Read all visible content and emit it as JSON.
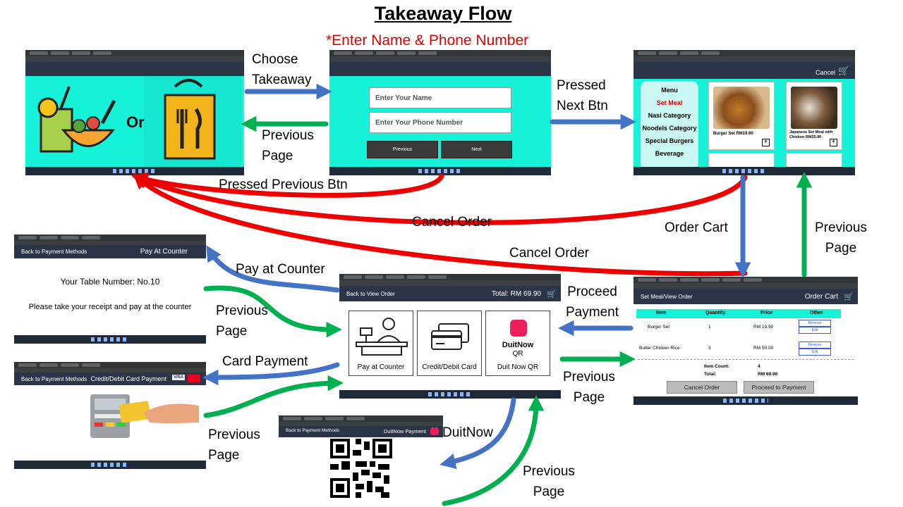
{
  "title": "Takeaway Flow",
  "note": "*Enter Name & Phone Number",
  "labels": {
    "choose_takeaway": [
      "Choose",
      "Takeaway"
    ],
    "prev_page_1": [
      "Previous",
      "Page"
    ],
    "pressed_next": [
      "Pressed",
      "Next Btn"
    ],
    "pressed_prev_btn": "Pressed Previous Btn",
    "cancel_order_1": "Cancel Order",
    "cancel_order_2": "Cancel Order",
    "order_cart": "Order Cart",
    "prev_page_2": [
      "Previous",
      "Page"
    ],
    "pay_at_counter": "Pay at Counter",
    "proceed_payment": [
      "Proceed",
      "Payment"
    ],
    "prev_page_3": [
      "Previous",
      "Page"
    ],
    "card_payment": "Card Payment",
    "prev_page_4": [
      "Previous",
      "Page"
    ],
    "prev_page_5": [
      "Previous",
      "Page"
    ],
    "duitnow": "DuitNow",
    "prev_page_6": [
      "Previous",
      "Page"
    ]
  },
  "screens": {
    "choice": {
      "or": "Or"
    },
    "details": {
      "name_placeholder": "Enter Your Name",
      "phone_placeholder": "Enter Your Phone Number",
      "prev_btn": "Previous",
      "next_btn": "Next"
    },
    "menu": {
      "cancel": "Cancel",
      "heading": "Menu",
      "categories": [
        "Set Meal",
        "Nasi Category",
        "Noodels Category",
        "Special Burgers",
        "Beverage"
      ],
      "items": [
        {
          "name": "Burger Set RM19.90"
        },
        {
          "name": "Japanese Set Meal with Chicken RM25.90"
        }
      ]
    },
    "counter": {
      "back": "Back to Payment Methods",
      "heading": "Pay At Counter",
      "table_no": "Your Table Number: No.10",
      "instruction": "Please take your receipt and pay at the counter"
    },
    "card": {
      "back": "Back to Payment Methods",
      "heading": "Credit/Debit Card Payment",
      "visa": "VISA"
    },
    "payment": {
      "back": "Back to View Order",
      "total": "Total: RM 69.90",
      "options": [
        "Pay at Counter",
        "Credit/Debit Card",
        "Duit Now QR"
      ],
      "duitnow_logo": [
        "DuitNow",
        "QR"
      ]
    },
    "cart": {
      "back": "Set Meal/View Order",
      "heading": "Order Cart",
      "columns": [
        "Item",
        "Quantity",
        "Price",
        "Other"
      ],
      "rows": [
        {
          "item": "Burger Set",
          "qty": "1",
          "price": "RM 19.90"
        },
        {
          "item": "Butter Chicken Rice",
          "qty": "3",
          "price": "RM 50.00"
        }
      ],
      "remove": "Remove",
      "edit": "Edit",
      "count_label": "Item Count:",
      "count_value": "4",
      "total_label": "Total:",
      "total_value": "RM 69.90",
      "cancel_btn": "Cancel Order",
      "proceed_btn": "Proceed to Payment"
    },
    "duitnow": {
      "back": "Back to Payment Methods",
      "heading": "DuitNow Payment"
    }
  },
  "colors": {
    "red": "#ee0000",
    "blue": "#4472c4",
    "green": "#00b050",
    "cyan": "#16f2d8"
  }
}
